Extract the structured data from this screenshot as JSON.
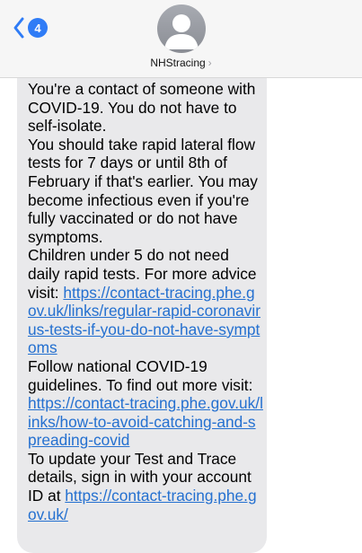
{
  "header": {
    "back_badge": "4",
    "contact_name": "NHStracing"
  },
  "message": {
    "para1": "You're a contact of someone with COVID-19. You do not have to self-isolate.",
    "para2": "You should take rapid lateral flow tests for 7 days or until 8th of February if that's earlier. You may become infectious even if you're fully vaccinated or do not have symptoms.",
    "para3_text": "Children under 5 do not need daily rapid tests. For more advice visit: ",
    "para3_link": "https://contact-tracing.phe.gov.uk/links/regular-rapid-coronavirus-tests-if-you-do-not-have-symptoms",
    "para4_text": "Follow national COVID-19 guidelines. To find out more visit: ",
    "para4_link": "https://contact-tracing.phe.gov.uk/links/how-to-avoid-catching-and-spreading-covid",
    "para5_text": "To update your Test and Trace details, sign in with your account ID at ",
    "para5_link": "https://contact-tracing.phe.gov.uk/"
  }
}
